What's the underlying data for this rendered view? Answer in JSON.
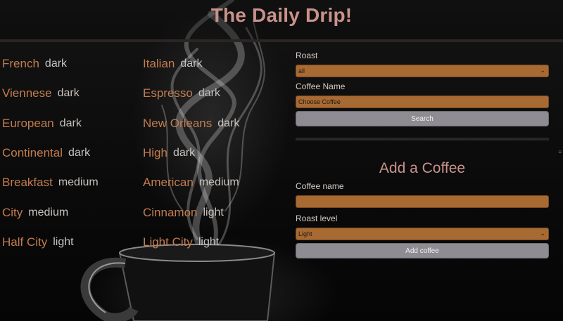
{
  "header": {
    "title": "The Daily Drip!"
  },
  "coffees_left": [
    {
      "name": "French",
      "roast": "dark"
    },
    {
      "name": "Viennese",
      "roast": "dark"
    },
    {
      "name": "European",
      "roast": "dark"
    },
    {
      "name": "Continental",
      "roast": "dark"
    },
    {
      "name": "Breakfast",
      "roast": "medium"
    },
    {
      "name": "City",
      "roast": "medium"
    },
    {
      "name": "Half City",
      "roast": "light"
    }
  ],
  "coffees_right": [
    {
      "name": "Italian",
      "roast": "dark"
    },
    {
      "name": "Espresso",
      "roast": "dark"
    },
    {
      "name": "New Orleans",
      "roast": "dark"
    },
    {
      "name": "High",
      "roast": "dark"
    },
    {
      "name": "American",
      "roast": "medium"
    },
    {
      "name": "Cinnamon",
      "roast": "light"
    },
    {
      "name": "Light City",
      "roast": "light"
    }
  ],
  "search_form": {
    "roast_label": "Roast",
    "roast_value": "all",
    "coffee_name_label": "Coffee Name",
    "coffee_name_value": "Choose Coffee",
    "search_button": "Search"
  },
  "add_form": {
    "title": "Add a Coffee",
    "coffee_name_label": "Coffee name",
    "coffee_name_value": "",
    "roast_level_label": "Roast level",
    "roast_level_value": "Light",
    "add_button": "Add coffee"
  },
  "colors": {
    "title": "#c8928b",
    "coffee_name": "#c37c4f",
    "field_bg": "#a86a33",
    "button_bg": "#8f8b92"
  }
}
